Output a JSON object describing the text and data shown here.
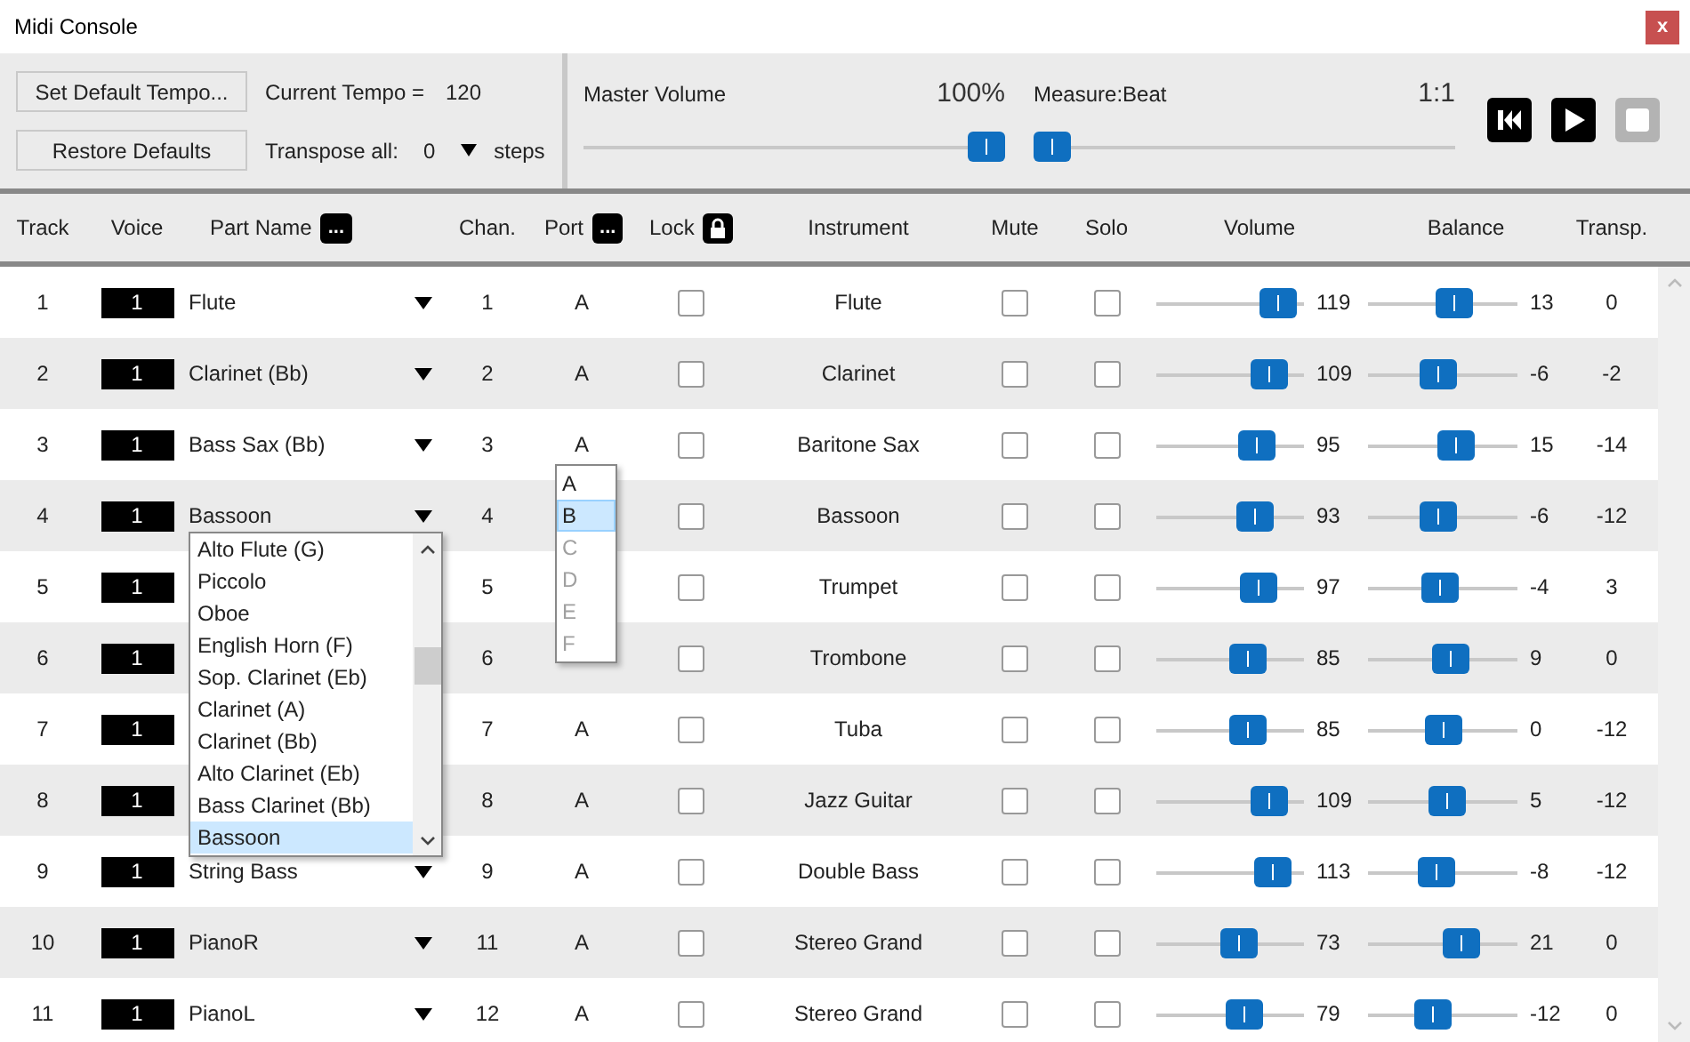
{
  "window": {
    "title": "Midi Console",
    "close": "x"
  },
  "toolbar": {
    "buttons": [
      "Set Default Tempo...",
      "Restore Defaults"
    ],
    "tempo_label": "Current Tempo =",
    "tempo_value": "120",
    "transpose_label": "Transpose all:",
    "transpose_value": "0",
    "transpose_unit": "steps",
    "master_volume": {
      "label": "Master Volume",
      "reading": "100%",
      "level": 1
    },
    "position": {
      "label": "Measure:Beat",
      "reading": "1:1",
      "level": 0
    },
    "transport": [
      {
        "kind": "rewind",
        "disabled": false
      },
      {
        "kind": "play",
        "disabled": false
      },
      {
        "kind": "stop",
        "disabled": true
      }
    ]
  },
  "columns": [
    {
      "label": "Track"
    },
    {
      "label": "Voice"
    },
    {
      "label": "Part Name",
      "button": "..."
    },
    {
      "label": "Chan."
    },
    {
      "label": "Port",
      "button": "..."
    },
    {
      "label": "Lock",
      "kind": "lock"
    },
    {
      "label": "Instrument"
    },
    {
      "label": "Mute"
    },
    {
      "label": "Solo"
    },
    {
      "label": "Volume"
    },
    {
      "label": "Balance"
    },
    {
      "label": "Transp."
    }
  ],
  "tracks": [
    {
      "track": "1",
      "voice": "1",
      "part_name": "Flute",
      "channel": "1",
      "port": "A",
      "lock": false,
      "instrument": "Flute",
      "mute": false,
      "solo": false,
      "volume": {
        "level": 0.937,
        "reading": "119"
      },
      "balance": {
        "level": 0.606,
        "reading": "13"
      },
      "transpose": "0"
    },
    {
      "track": "2",
      "voice": "1",
      "part_name": "Clarinet (Bb)",
      "channel": "2",
      "port": "A",
      "lock": false,
      "instrument": "Clarinet",
      "mute": false,
      "solo": false,
      "volume": {
        "level": 0.858,
        "reading": "109"
      },
      "balance": {
        "level": 0.457,
        "reading": "-6"
      },
      "transpose": "-2"
    },
    {
      "track": "3",
      "voice": "1",
      "part_name": "Bass Sax (Bb)",
      "channel": "3",
      "port": "A",
      "lock": false,
      "instrument": "Baritone Sax",
      "mute": false,
      "solo": false,
      "volume": {
        "level": 0.748,
        "reading": "95"
      },
      "balance": {
        "level": 0.622,
        "reading": "15"
      },
      "transpose": "-14"
    },
    {
      "track": "4",
      "voice": "1",
      "part_name": "Bassoon",
      "channel": "4",
      "lock": false,
      "instrument": "Bassoon",
      "mute": false,
      "solo": false,
      "volume": {
        "level": 0.732,
        "reading": "93"
      },
      "balance": {
        "level": 0.457,
        "reading": "-6"
      },
      "transpose": "-12"
    },
    {
      "track": "5",
      "voice": "1",
      "channel": "5",
      "lock": false,
      "instrument": "Trumpet",
      "mute": false,
      "solo": false,
      "volume": {
        "level": 0.764,
        "reading": "97"
      },
      "balance": {
        "level": 0.472,
        "reading": "-4"
      },
      "transpose": "3"
    },
    {
      "track": "6",
      "voice": "1",
      "channel": "6",
      "lock": false,
      "instrument": "Trombone",
      "mute": false,
      "solo": false,
      "volume": {
        "level": 0.669,
        "reading": "85"
      },
      "balance": {
        "level": 0.575,
        "reading": "9"
      },
      "transpose": "0"
    },
    {
      "track": "7",
      "voice": "1",
      "channel": "7",
      "port": "A",
      "lock": false,
      "instrument": "Tuba",
      "mute": false,
      "solo": false,
      "volume": {
        "level": 0.669,
        "reading": "85"
      },
      "balance": {
        "level": 0.504,
        "reading": "0"
      },
      "transpose": "-12"
    },
    {
      "track": "8",
      "voice": "1",
      "channel": "8",
      "port": "A",
      "lock": false,
      "instrument": "Jazz Guitar",
      "mute": false,
      "solo": false,
      "volume": {
        "level": 0.858,
        "reading": "109"
      },
      "balance": {
        "level": 0.543,
        "reading": "5"
      },
      "transpose": "-12"
    },
    {
      "track": "9",
      "voice": "1",
      "part_name": "String Bass",
      "channel": "9",
      "port": "A",
      "lock": false,
      "instrument": "Double Bass",
      "mute": false,
      "solo": false,
      "volume": {
        "level": 0.89,
        "reading": "113"
      },
      "balance": {
        "level": 0.441,
        "reading": "-8"
      },
      "transpose": "-12"
    },
    {
      "track": "10",
      "voice": "1",
      "part_name": "PianoR",
      "channel": "11",
      "port": "A",
      "lock": false,
      "instrument": "Stereo Grand",
      "mute": false,
      "solo": false,
      "volume": {
        "level": 0.575,
        "reading": "73"
      },
      "balance": {
        "level": 0.669,
        "reading": "21"
      },
      "transpose": "0"
    },
    {
      "track": "11",
      "voice": "1",
      "part_name": "PianoL",
      "channel": "12",
      "port": "A",
      "lock": false,
      "instrument": "Stereo Grand",
      "mute": false,
      "solo": false,
      "volume": {
        "level": 0.622,
        "reading": "79"
      },
      "balance": {
        "level": 0.409,
        "reading": "-12"
      },
      "transpose": "0"
    }
  ],
  "part_name_dropdown": {
    "items": [
      {
        "label": "Alto Flute (G)",
        "selected": false
      },
      {
        "label": "Piccolo",
        "selected": false
      },
      {
        "label": "Oboe",
        "selected": false
      },
      {
        "label": "English Horn (F)",
        "selected": false
      },
      {
        "label": "Sop. Clarinet (Eb)",
        "selected": false
      },
      {
        "label": "Clarinet (A)",
        "selected": false
      },
      {
        "label": "Clarinet (Bb)",
        "selected": false
      },
      {
        "label": "Alto Clarinet (Eb)",
        "selected": false
      },
      {
        "label": "Bass Clarinet (Bb)",
        "selected": false
      },
      {
        "label": "Bassoon",
        "selected": true
      }
    ]
  },
  "port_dropdown": {
    "items": [
      {
        "label": "A",
        "selected": false,
        "disabled": false
      },
      {
        "label": "B",
        "selected": true,
        "disabled": false
      },
      {
        "label": "C",
        "selected": false,
        "disabled": true
      },
      {
        "label": "D",
        "selected": false,
        "disabled": true
      },
      {
        "label": "E",
        "selected": false,
        "disabled": true
      },
      {
        "label": "F",
        "selected": false,
        "disabled": true
      }
    ]
  }
}
